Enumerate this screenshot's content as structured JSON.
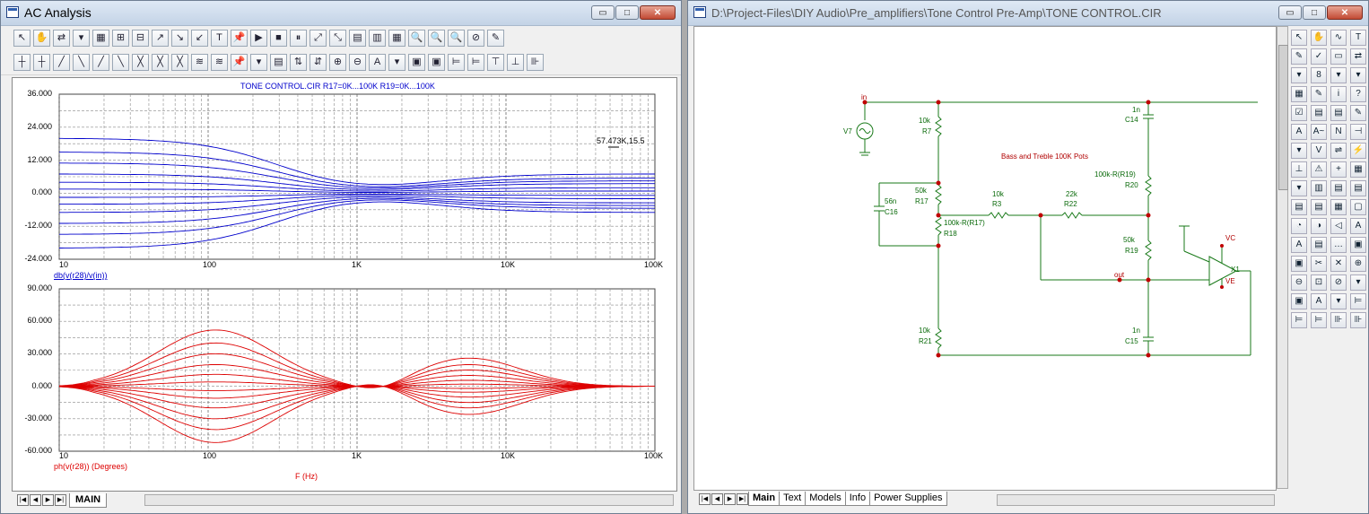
{
  "left_window": {
    "title": "AC Analysis",
    "window_buttons": [
      "▭",
      "□",
      "✕"
    ],
    "toolbar1": [
      "↖",
      "✋",
      "⇄",
      "▾",
      "▦",
      "⊞",
      "⊟",
      "↗",
      "↘",
      "↙",
      "T",
      "📌",
      "▶",
      "■",
      "⏸",
      "⤢",
      "⤡",
      "▤",
      "▥",
      "▦",
      "🔍",
      "🔍",
      "🔍",
      "⊘",
      "✎"
    ],
    "toolbar2": [
      "┼",
      "┼",
      "╱",
      "╲",
      "╱",
      "╲",
      "╳",
      "╳",
      "╳",
      "≋",
      "≋",
      "📌",
      "▾",
      "▤",
      "⇅",
      "⇵",
      "⊕",
      "⊖",
      "A",
      "▾",
      "▣",
      "▣",
      "⊨",
      "⊨",
      "⊤",
      "⊥",
      "⊪"
    ],
    "graph": {
      "title": "TONE CONTROL.CIR R17=0K...100K R19=0K...100K",
      "top_plot": {
        "label": "db(v(r28)/v(in))",
        "y_ticks": [
          "36.000",
          "24.000",
          "12.000",
          "0.000",
          "-12.000",
          "-24.000"
        ],
        "color": "#0000cc",
        "cursor_readout": "57.473K,15.5"
      },
      "bottom_plot": {
        "label": "ph(v(r28)) (Degrees)",
        "y_ticks": [
          "90.000",
          "60.000",
          "30.000",
          "0.000",
          "-30.000",
          "-60.000"
        ],
        "color": "#dd0000"
      },
      "x_ticks": [
        "10",
        "100",
        "1K",
        "10K",
        "100K"
      ],
      "x_axis_label": "F (Hz)"
    },
    "sheet_tab": "MAIN"
  },
  "right_window": {
    "title": "D:\\Project-Files\\DIY Audio\\Pre_amplifiers\\Tone Control Pre-Amp\\TONE CONTROL.CIR",
    "window_buttons": [
      "▭",
      "□",
      "✕"
    ],
    "schematic": {
      "note": "Bass and Treble 100K Pots",
      "components": {
        "v7": "V7",
        "r7": "R7",
        "r7_val": "10k",
        "c14": "C14",
        "c14_val": "1n",
        "r17": "R17",
        "r17_val": "50k",
        "c16": "C16",
        "c16_val": "56n",
        "r3": "R3",
        "r3_val": "10k",
        "r22": "R22",
        "r22_val": "22k",
        "r18": "R18",
        "r18_val": "100k-R(R17)",
        "r20": "R20",
        "r20_val": "100k-R(R19)",
        "r19": "R19",
        "r19_val": "50k",
        "r21": "R21",
        "r21_val": "10k",
        "c15": "C15",
        "c15_val": "1n",
        "x1": "X1",
        "vc": "VC",
        "ve": "VE"
      },
      "nodes": {
        "in": "in",
        "out": "out"
      }
    },
    "component_toolbar": [
      "↖",
      "✋",
      "∿",
      "T",
      "✎",
      "✓",
      "▭",
      "⇄",
      "▾",
      "8",
      "▾",
      "▾",
      "▦",
      "✎",
      "i",
      "?",
      "☑",
      "▤",
      "▤",
      "✎",
      "A",
      "A~",
      "N",
      "⊣",
      "▾",
      "V",
      "⇌",
      "⚡",
      "⊥",
      "⚠",
      "+",
      "▦",
      "▾",
      "▥",
      "▤",
      "▤",
      "▤",
      "▤",
      "▦",
      "▢",
      "◔",
      "◑",
      "◁",
      "A",
      "A",
      "▤",
      "…",
      "▣",
      "▣",
      "✂",
      "✕",
      "⊕",
      "⊖",
      "⊡",
      "⊘",
      "▾",
      "▣",
      "A",
      "▾",
      "⊨",
      "⊨",
      "⊨",
      "⊪",
      "⊪"
    ],
    "tabs": [
      "Main",
      "Text",
      "Models",
      "Info",
      "Power Supplies"
    ]
  }
}
